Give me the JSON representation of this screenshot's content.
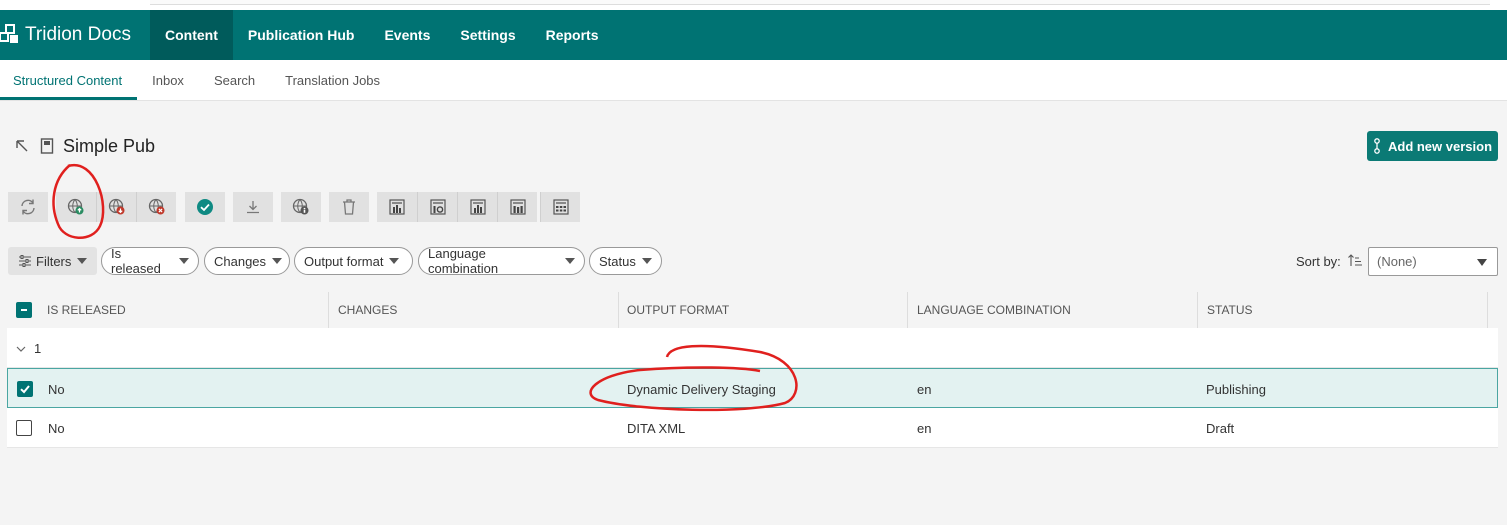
{
  "app": {
    "name": "Tridion Docs"
  },
  "nav": {
    "items": [
      "Content",
      "Publication Hub",
      "Events",
      "Settings",
      "Reports"
    ]
  },
  "subnav": {
    "items": [
      "Structured Content",
      "Inbox",
      "Search",
      "Translation Jobs"
    ]
  },
  "page": {
    "title": "Simple Pub",
    "add_version_label": "Add new version"
  },
  "toolbar": {
    "buttons": [
      "refresh-icon",
      "publish-icon",
      "unpublish-icon",
      "cancel-publish-icon",
      "release-icon",
      "download-icon",
      "globe-preview-icon",
      "delete-icon",
      "report-1-icon",
      "report-2-icon",
      "report-3-icon",
      "report-4-icon",
      "report-5-icon"
    ]
  },
  "filters": {
    "filters_label": "Filters",
    "chips": [
      "Is released",
      "Changes",
      "Output format",
      "Language combination",
      "Status"
    ],
    "sort_label": "Sort by:",
    "sort_value": "(None)"
  },
  "grid": {
    "columns": [
      "IS RELEASED",
      "CHANGES",
      "OUTPUT FORMAT",
      "LANGUAGE COMBINATION",
      "STATUS"
    ],
    "group_label": "1",
    "rows": [
      {
        "is_released": "No",
        "changes": "",
        "output_format": "Dynamic Delivery Staging",
        "language": "en",
        "status": "Publishing",
        "selected": true
      },
      {
        "is_released": "No",
        "changes": "",
        "output_format": "DITA XML",
        "language": "en",
        "status": "Draft",
        "selected": false
      }
    ]
  },
  "colors": {
    "brand": "#007373",
    "brand_dark": "#005b5b",
    "annotation": "#e0201e"
  }
}
